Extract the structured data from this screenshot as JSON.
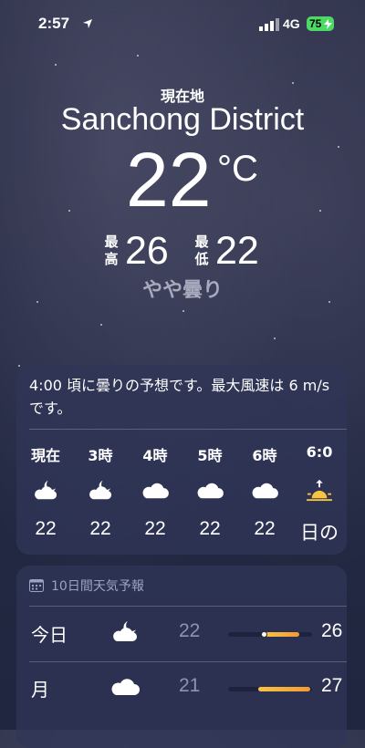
{
  "status_bar": {
    "time": "2:57",
    "network": "4G",
    "battery": "75"
  },
  "location_label": "現在地",
  "city": "Sanchong District",
  "current": {
    "temp": "22",
    "unit": "°C",
    "high_tag": "最高",
    "high": "26",
    "low_tag": "最低",
    "low": "22",
    "condition": "やや曇り"
  },
  "hourly": {
    "summary": "4:00 頃に曇りの予想です。最大風速は 6 m/s です。",
    "hours": [
      {
        "label": "現在",
        "icon": "moon-cloud-icon",
        "temp": "22"
      },
      {
        "label": "3時",
        "icon": "moon-cloud-icon",
        "temp": "22"
      },
      {
        "label": "4時",
        "icon": "cloud-icon",
        "temp": "22"
      },
      {
        "label": "5時",
        "icon": "cloud-icon",
        "temp": "22"
      },
      {
        "label": "6時",
        "icon": "cloud-icon",
        "temp": "22"
      },
      {
        "label": "6:0",
        "icon": "sunrise-icon",
        "temp": "日の"
      }
    ]
  },
  "daily": {
    "title": "10日間天気予報",
    "days": [
      {
        "name": "今日",
        "icon": "moon-cloud-icon",
        "low": "22",
        "high": "26",
        "range_start": 0.45,
        "range_end": 0.85,
        "current_marker": 0.42
      },
      {
        "name": "月",
        "icon": "cloud-icon",
        "low": "21",
        "high": "27",
        "range_start": 0.36,
        "range_end": 0.98
      }
    ]
  },
  "colors": {
    "bar_warm": "#f6c443",
    "bar_hot": "#f29a34",
    "battery": "#4cd964"
  }
}
